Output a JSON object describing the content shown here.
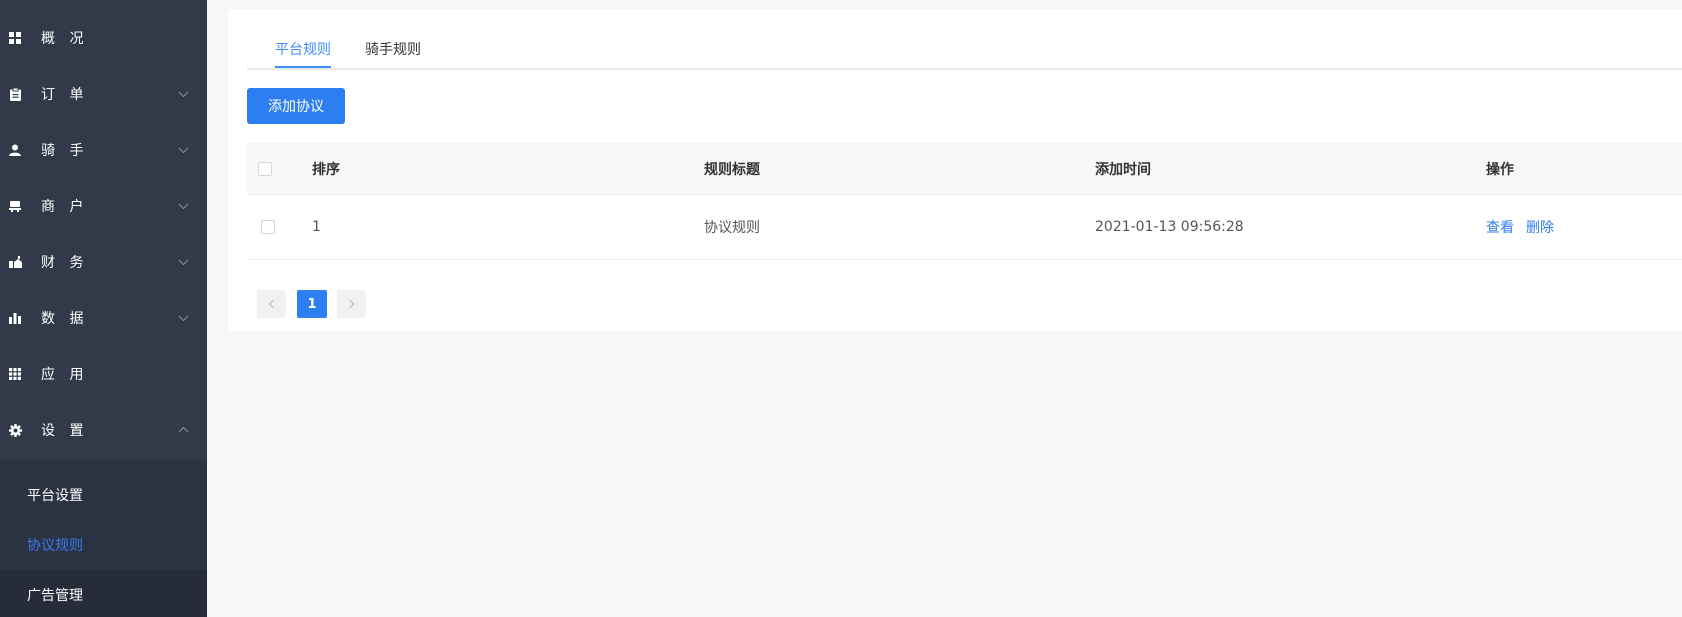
{
  "sidebar": {
    "items": [
      {
        "label": "概 况",
        "icon": "grid-icon",
        "has_chevron": false
      },
      {
        "label": "订 单",
        "icon": "clipboard-icon",
        "has_chevron": true
      },
      {
        "label": "骑 手",
        "icon": "user-icon",
        "has_chevron": true
      },
      {
        "label": "商 户",
        "icon": "shop-icon",
        "has_chevron": true
      },
      {
        "label": "财 务",
        "icon": "wallet-icon",
        "has_chevron": true
      },
      {
        "label": "数 据",
        "icon": "bar-chart-icon",
        "has_chevron": true
      },
      {
        "label": "应 用",
        "icon": "apps-icon",
        "has_chevron": false
      },
      {
        "label": "设 置",
        "icon": "gear-icon",
        "has_chevron": true,
        "expanded": true
      }
    ],
    "submenu": [
      {
        "label": "平台设置"
      },
      {
        "label": "协议规则",
        "active": true
      },
      {
        "label": "广告管理"
      }
    ]
  },
  "tabs": [
    {
      "label": "平台规则",
      "active": true
    },
    {
      "label": "骑手规则"
    }
  ],
  "toolbar": {
    "add_label": "添加协议"
  },
  "table": {
    "headers": {
      "order": "排序",
      "title": "规则标题",
      "time": "添加时间",
      "actions": "操作"
    },
    "rows": [
      {
        "order": "1",
        "title": "协议规则",
        "time": "2021-01-13 09:56:28",
        "view": "查看",
        "delete": "删除"
      }
    ]
  },
  "pagination": {
    "current": "1"
  },
  "colors": {
    "sidebar": "#323949",
    "accent": "#2d7ef0",
    "active_submenu": "#3e7bf0"
  }
}
